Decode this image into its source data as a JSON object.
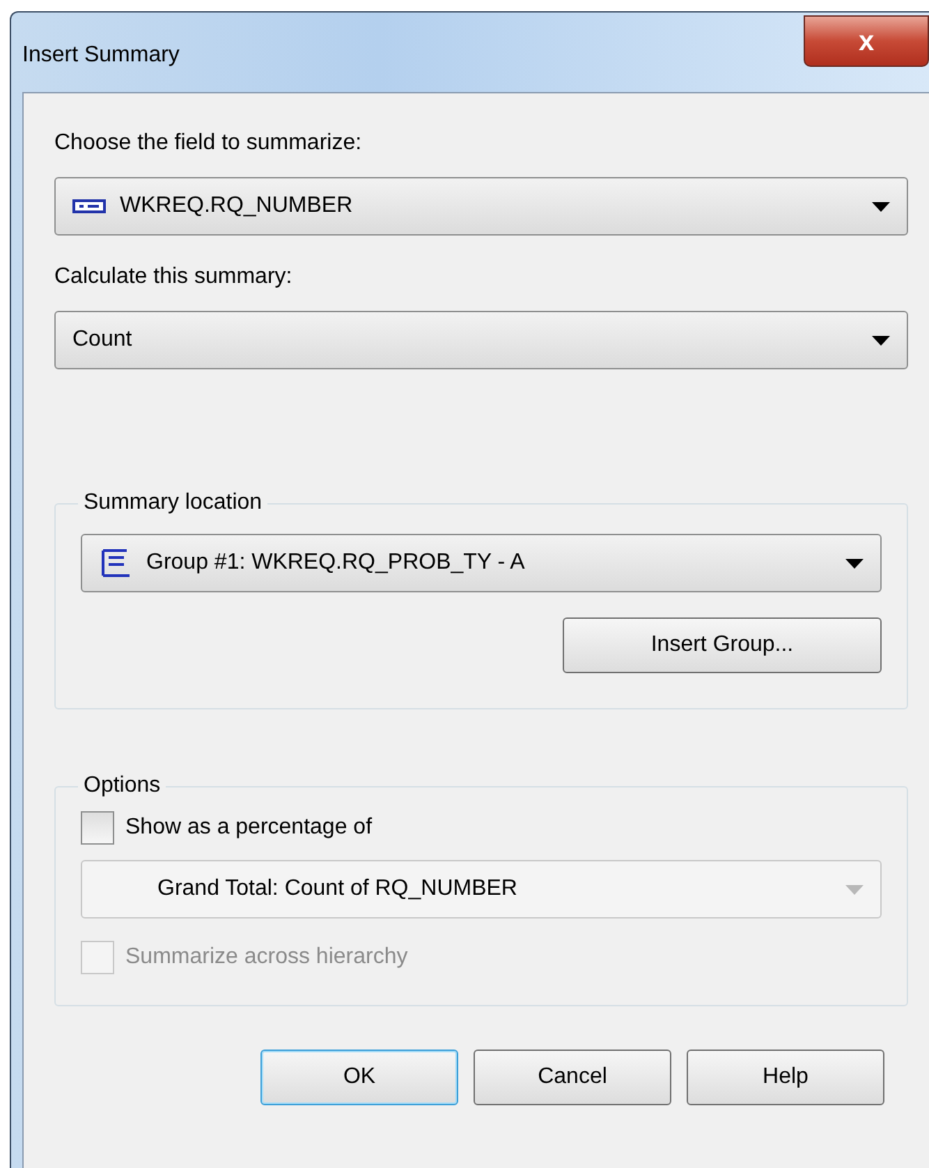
{
  "window": {
    "title": "Insert Summary",
    "close_label": "x"
  },
  "field": {
    "label": "Choose the field to summarize:",
    "value": "WKREQ.RQ_NUMBER",
    "disabled": false
  },
  "summary": {
    "label": "Calculate this summary:",
    "value": "Count",
    "disabled": false
  },
  "location": {
    "legend": "Summary location",
    "value": "Group #1: WKREQ.RQ_PROB_TY - A",
    "disabled": false,
    "button": "Insert Group..."
  },
  "options": {
    "legend": "Options",
    "checkboxes": [
      {
        "label": "Show as a percentage of",
        "checked": false,
        "disabled": false
      },
      {
        "label": "Summarize across hierarchy",
        "checked": false,
        "disabled": true
      }
    ],
    "percentage": {
      "value": "Grand Total: Count of RQ_NUMBER",
      "disabled": true
    }
  },
  "buttons": [
    {
      "label": "OK",
      "default": true
    },
    {
      "label": "Cancel",
      "default": false
    },
    {
      "label": "Help",
      "default": false
    }
  ]
}
